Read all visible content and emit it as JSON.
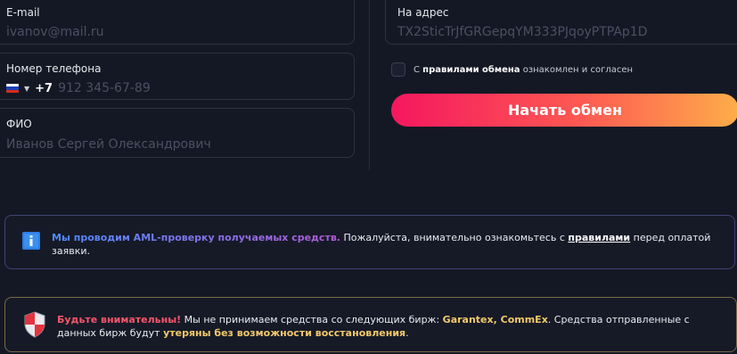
{
  "form": {
    "email": {
      "label": "E-mail",
      "placeholder": "ivanov@mail.ru"
    },
    "phone": {
      "label": "Номер телефона",
      "country_code": "+7",
      "placeholder": "912 345-67-89",
      "flag_icon": "russia-flag-icon"
    },
    "fio": {
      "label": "ФИО",
      "placeholder": "Иванов Сергей Олександрович"
    },
    "address": {
      "label": "На адрес",
      "placeholder": "TX2SticTrJfGRGepqYM333PJqoyPTPAp1D"
    }
  },
  "agreement": {
    "prefix": "С ",
    "link": "правилами обмена",
    "suffix": " ознакомлен и согласен",
    "checked": false
  },
  "submit_label": "Начать обмен",
  "aml_notice": {
    "icon": "info-icon",
    "accent": "Мы проводим AML-проверку получаемых средств.",
    "text1": " Пожалуйста, внимательно ознакомьтесь с ",
    "link": "правилами",
    "text2": " перед оплатой заявки."
  },
  "warning_notice": {
    "icon": "shield-icon",
    "accent": "Будьте внимательны!",
    "text1": " Мы не принимаем средства со следующих бирж: ",
    "exchanges": "Garantex, CommEx",
    "text2": ". Средства отправленные с данных бирж будут ",
    "lost": "утеряны без возможности восстановления",
    "text3": "."
  },
  "colors": {
    "background": "#141824",
    "button_gradient_start": "#f5175f",
    "button_gradient_end": "#fdad4a",
    "warning_red": "#f7556a",
    "warning_gold": "#f3c96b",
    "aml_border": "#3f4374"
  }
}
